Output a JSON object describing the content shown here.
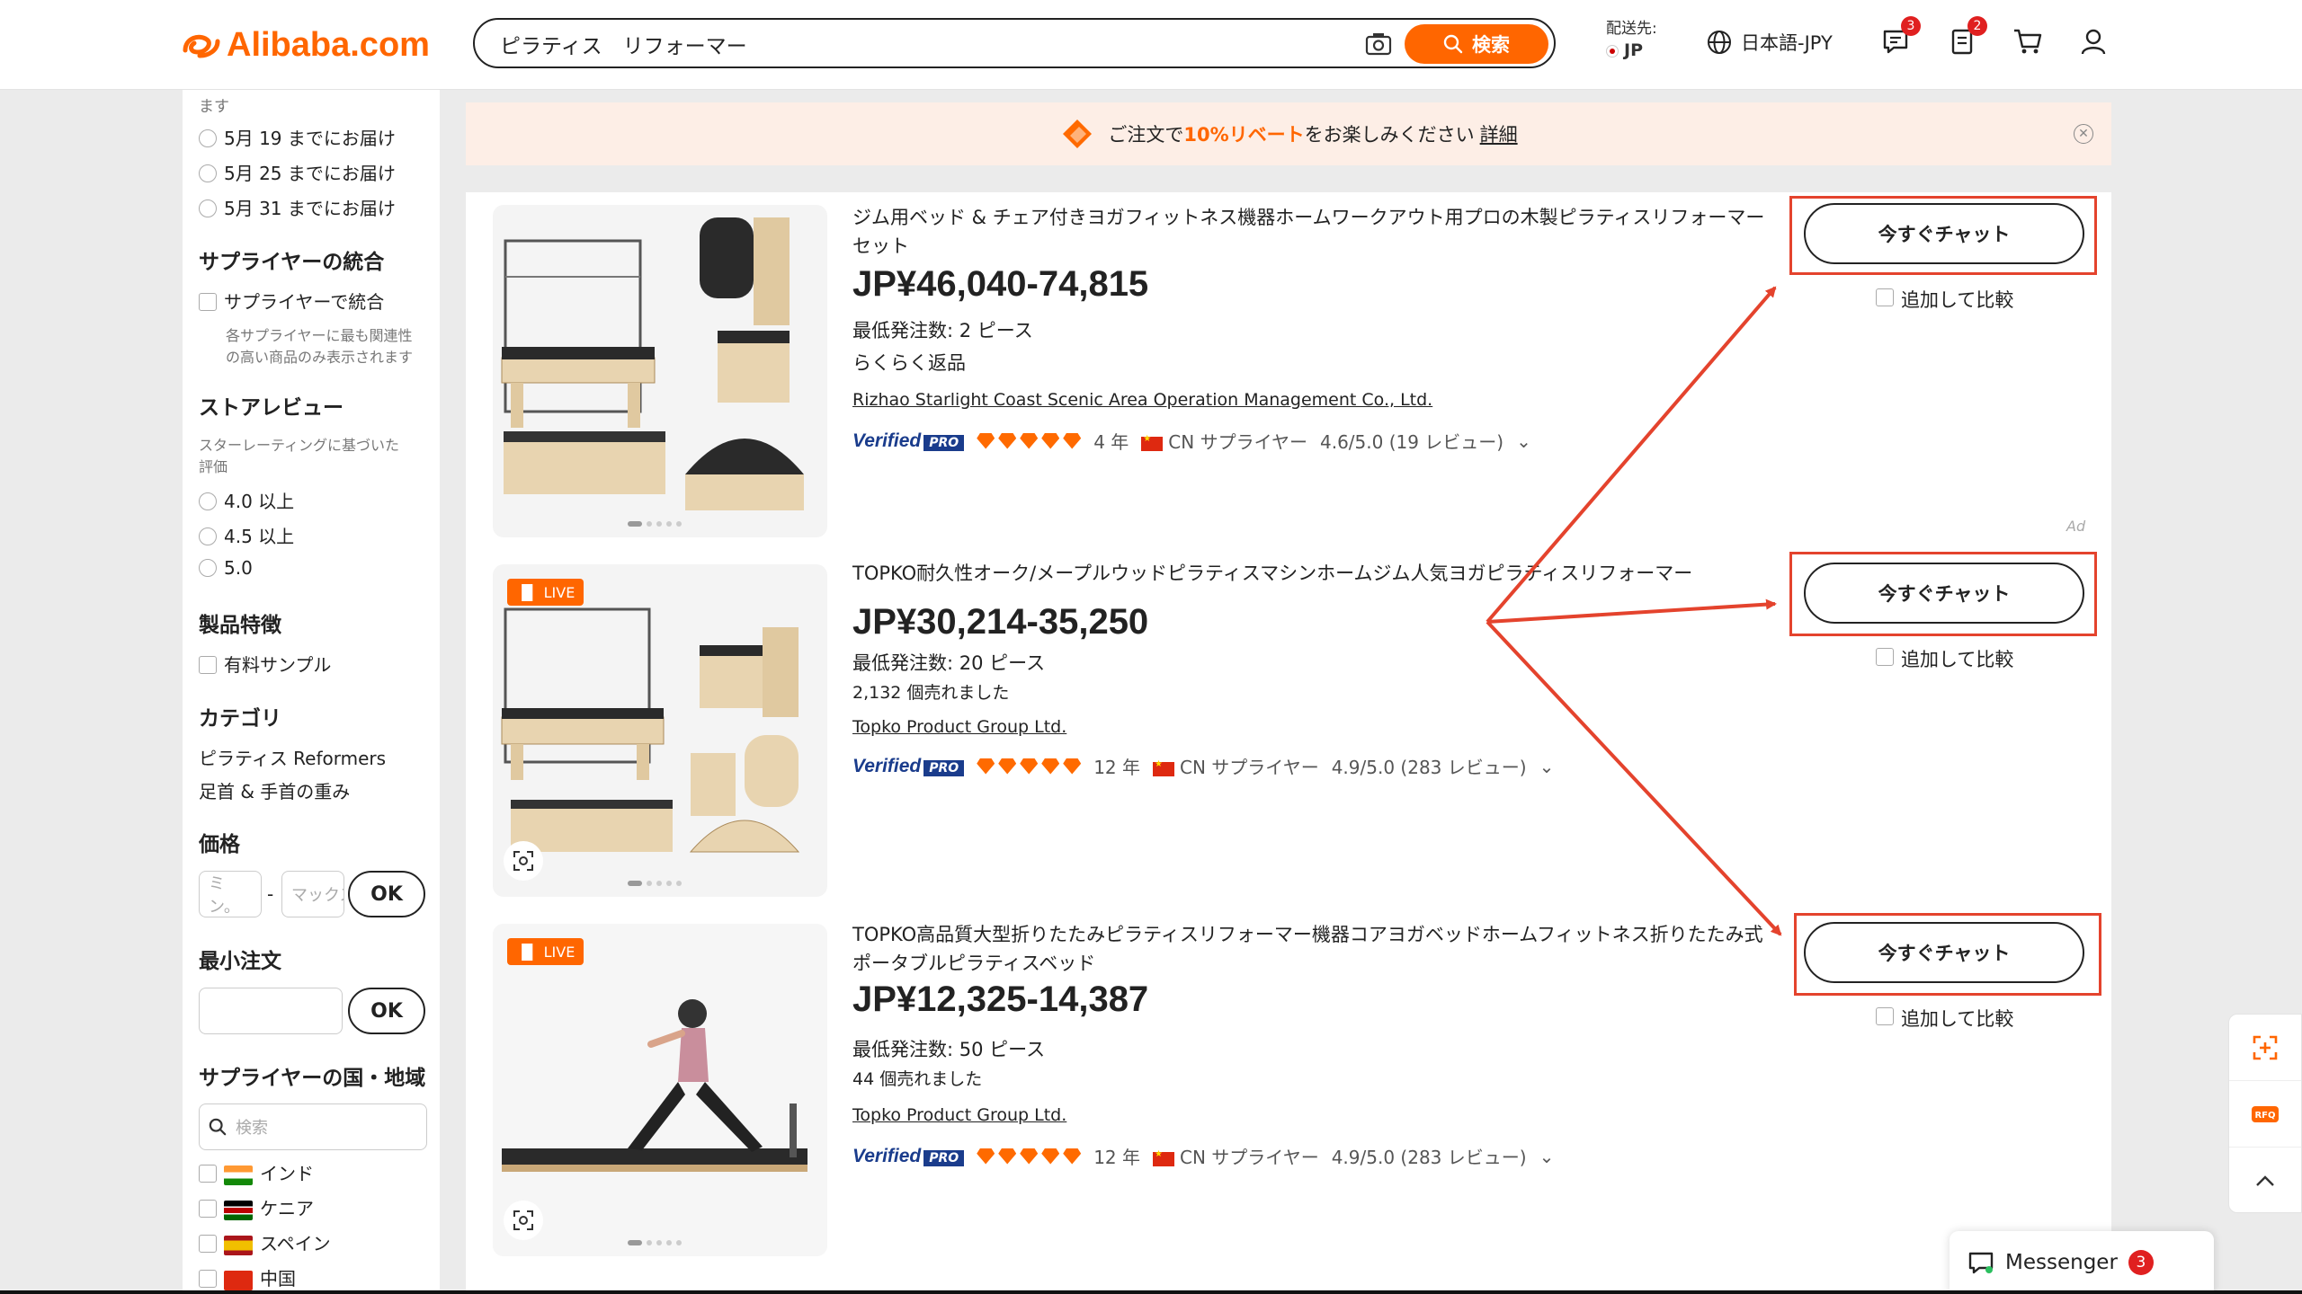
{
  "header": {
    "logo_text": "Alibaba.com",
    "search_value": "ピラティス　リフォーマー",
    "search_button": "検索",
    "ship_label": "配送先:",
    "ship_country": "JP",
    "language": "日本語-JPY",
    "messages_badge": "3",
    "orders_badge": "2"
  },
  "sidebar": {
    "truncated_text": "ます",
    "delivery": [
      "5月 19 までにお届け",
      "5月 25 までにお届け",
      "5月 31 までにお届け"
    ],
    "supplier_merge_head": "サプライヤーの統合",
    "supplier_merge_option": "サプライヤーで統合",
    "supplier_merge_note1": "各サプライヤーに最も関連性",
    "supplier_merge_note2": "の高い商品のみ表示されます",
    "store_review_head": "ストアレビュー",
    "store_review_note1": "スターレーティングに基づいた",
    "store_review_note2": "評価",
    "ratings": [
      "4.0 以上",
      "4.5 以上",
      "5.0"
    ],
    "product_features_head": "製品特徴",
    "free_sample": "有料サンプル",
    "category_head": "カテゴリ",
    "categories": [
      "ピラティス Reformers",
      "足首 & 手首の重み"
    ],
    "price_head": "価格",
    "price_min_placeholder": "ミン。",
    "price_max_placeholder": "マックス",
    "ok": "OK",
    "moq_head": "最小注文",
    "country_head": "サプライヤーの国・地域",
    "country_search_placeholder": "検索",
    "countries": [
      "インド",
      "ケニア",
      "スペイン",
      "中国"
    ]
  },
  "promo": {
    "prefix": "ご注文で",
    "highlight": "10%リベート",
    "suffix": "をお楽しみください",
    "link": "詳細"
  },
  "products": [
    {
      "title": "ジム用ベッド & チェア付きヨガフィットネス機器ホームワークアウト用プロの木製ピラティスリフォーマーセット",
      "price": "JP¥46,040-74,815",
      "moq": "最低発注数: 2 ピース",
      "extra": "らくらく返品",
      "supplier": "Rizhao Starlight Coast Scenic Area Operation Management Co., Ltd.",
      "years": "4 年",
      "country": "CN サプライヤー",
      "rating": "4.6/5.0 (19 レビュー)",
      "live": false
    },
    {
      "title": "TOPKO耐久性オーク/メープルウッドピラティスマシンホームジム人気ヨガピラティスリフォーマー",
      "price": "JP¥30,214-35,250",
      "moq": "最低発注数: 20 ピース",
      "extra": "2,132 個売れました",
      "supplier": "Topko Product Group Ltd.",
      "years": "12 年",
      "country": "CN サプライヤー",
      "rating": "4.9/5.0 (283 レビュー)",
      "live": true
    },
    {
      "title": "TOPKO高品質大型折りたたみピラティスリフォーマー機器コアヨガベッドホームフィットネス折りたたみ式ポータブルピラティスベッド",
      "price": "JP¥12,325-14,387",
      "moq": "最低発注数: 50 ピース",
      "extra": "44 個売れました",
      "supplier": "Topko Product Group Ltd.",
      "years": "12 年",
      "country": "CN サプライヤー",
      "rating": "4.9/5.0 (283 レビュー)",
      "live": true
    }
  ],
  "labels": {
    "chat_now": "今すぐチャット",
    "compare": "追加して比較",
    "verified": "Verified",
    "pro": "PRO",
    "live": "LIVE",
    "ad": "Ad"
  },
  "messenger": {
    "label": "Messenger",
    "count": "3"
  },
  "colors": {
    "brand": "#ff6600",
    "annotation": "#e4432d",
    "verified_blue": "#1a3c8c"
  }
}
